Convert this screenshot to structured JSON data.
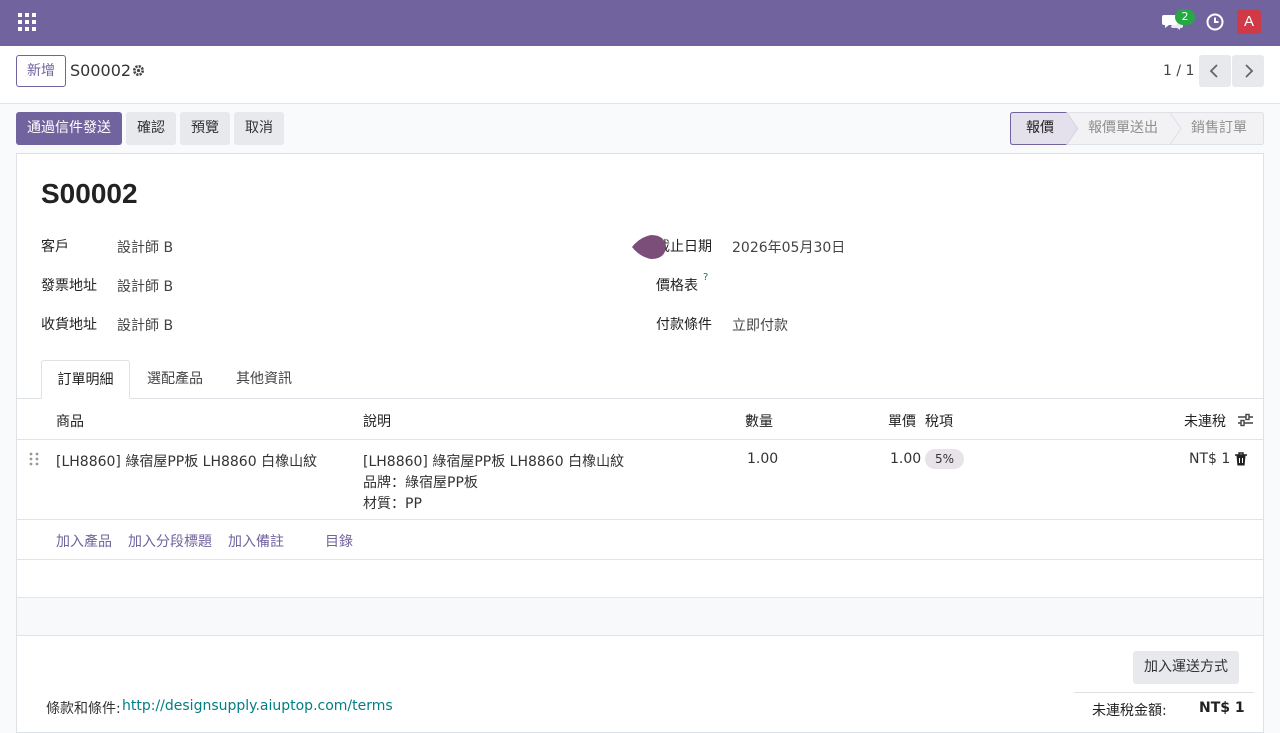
{
  "navbar": {
    "messages_badge": "2",
    "avatar_letter": "A",
    "colors": {
      "brand": "#71639e",
      "avatar": "#d03a47",
      "badge": "#28a745"
    }
  },
  "control_panel": {
    "new_label": "新增",
    "record_name": "S00002",
    "pager": "1 / 1"
  },
  "actions": {
    "send_email": "通過信件發送",
    "confirm": "確認",
    "preview": "預覽",
    "cancel": "取消"
  },
  "status_bar": {
    "stages": [
      "報價",
      "報價單送出",
      "銷售訂單"
    ],
    "current": "報價"
  },
  "form": {
    "title": "S00002",
    "customer_label": "客戶",
    "customer": "設計師 B",
    "invoice_addr_label": "發票地址",
    "invoice_addr": "設計師 B",
    "delivery_addr_label": "收貨地址",
    "delivery_addr": "設計師 B",
    "expiration_label": "截止日期",
    "expiration": "2026年05月30日",
    "pricelist_label": "價格表",
    "pricelist_help": "?",
    "payment_terms_label": "付款條件",
    "payment_terms": "立即付款"
  },
  "tabs": [
    "訂單明細",
    "選配產品",
    "其他資訊"
  ],
  "order_lines": {
    "headers": {
      "product": "商品",
      "description": "說明",
      "quantity": "數量",
      "unit_price": "單價",
      "taxes": "稅項",
      "subtotal": "未連稅"
    },
    "rows": [
      {
        "product": "[LH8860] 綠宿屋PP板 LH8860 白橡山紋",
        "description_lines": [
          "[LH8860] 綠宿屋PP板 LH8860 白橡山紋",
          "品牌：綠宿屋PP板",
          "材質：PP"
        ],
        "quantity": "1.00",
        "unit_price": "1.00",
        "tax": "5%",
        "subtotal": "NT$ 1"
      }
    ],
    "add_product": "加入產品",
    "add_section": "加入分段標題",
    "add_note": "加入備註",
    "catalog": "目錄"
  },
  "footer": {
    "add_shipping": "加入運送方式",
    "terms_label": "條款和條件:",
    "terms_url": "http://designsupply.aiuptop.com/terms",
    "untaxed_label": "未連稅金額:",
    "untaxed_value": "NT$ 1"
  }
}
